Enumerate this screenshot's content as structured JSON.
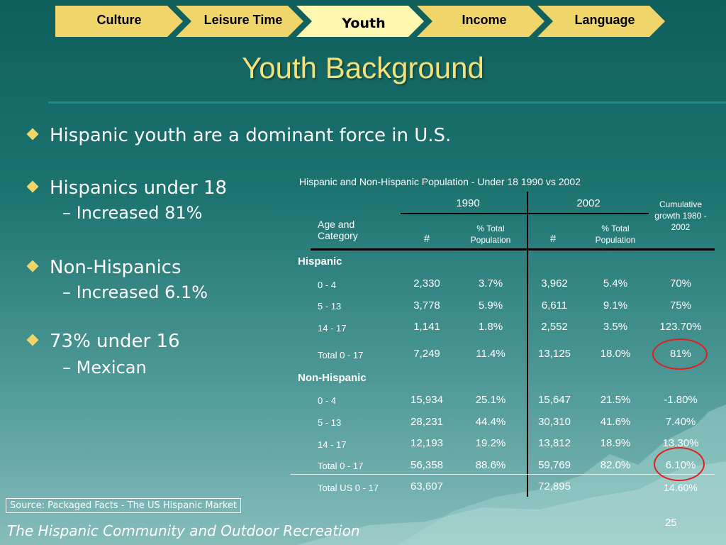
{
  "nav": {
    "tabs": [
      {
        "label": "Culture"
      },
      {
        "label": "Leisure Time"
      },
      {
        "label": "Youth"
      },
      {
        "label": "Income"
      },
      {
        "label": "Language"
      }
    ]
  },
  "slide": {
    "title": "Youth Background",
    "bullets": [
      {
        "text": "Hispanic youth are a dominant force in U.S."
      },
      {
        "text": "Hispanics under 18",
        "sub": "Increased 81%"
      },
      {
        "text": "Non-Hispanics",
        "sub": "Increased 6.1%"
      },
      {
        "text": "73% under 16",
        "sub": "Mexican"
      }
    ],
    "dash": "–"
  },
  "table": {
    "caption": "Hispanic and Non-Hispanic Population - Under 18      1990 vs 2002",
    "year_1990": "1990",
    "year_2002": "2002",
    "col_age": "Age and Category",
    "col_num": "#",
    "col_pct": "% Total Population",
    "col_growth": "Cumulative growth 1980 - 2002",
    "groups": [
      {
        "name": "Hispanic",
        "rows": [
          {
            "label": "0 - 4",
            "n1990": "2,330",
            "p1990": "3.7%",
            "n2002": "3,962",
            "p2002": "5.4%",
            "growth": "70%"
          },
          {
            "label": "5 - 13",
            "n1990": "3,778",
            "p1990": "5.9%",
            "n2002": "6,611",
            "p2002": "9.1%",
            "growth": "75%"
          },
          {
            "label": "14 - 17",
            "n1990": "1,141",
            "p1990": "1.8%",
            "n2002": "2,552",
            "p2002": "3.5%",
            "growth": "123.70%"
          },
          {
            "label": "Total 0 - 17",
            "n1990": "7,249",
            "p1990": "11.4%",
            "n2002": "13,125",
            "p2002": "18.0%",
            "growth": "81%"
          }
        ]
      },
      {
        "name": "Non-Hispanic",
        "rows": [
          {
            "label": "0 - 4",
            "n1990": "15,934",
            "p1990": "25.1%",
            "n2002": "15,647",
            "p2002": "21.5%",
            "growth": "-1.80%"
          },
          {
            "label": "5 - 13",
            "n1990": "28,231",
            "p1990": "44.4%",
            "n2002": "30,310",
            "p2002": "41.6%",
            "growth": "7.40%"
          },
          {
            "label": "14 - 17",
            "n1990": "12,193",
            "p1990": "19.2%",
            "n2002": "13,812",
            "p2002": "18.9%",
            "growth": "13.30%"
          },
          {
            "label": "Total 0 - 17",
            "n1990": "56,358",
            "p1990": "88.6%",
            "n2002": "59,769",
            "p2002": "82.0%",
            "growth": "6.10%"
          }
        ]
      }
    ],
    "total_us": {
      "label": "Total US 0 - 17",
      "n1990": "63,607",
      "n2002": "72,895",
      "growth": "14.60%"
    }
  },
  "source": "Source: Packaged Facts - The US Hispanic Market",
  "footer": "The Hispanic Community and Outdoor Recreation",
  "page_number": "25",
  "colors": {
    "tab": "#f0d66a",
    "tab_active": "#fff7b0",
    "title": "#f3e27a",
    "highlight": "#e0201f"
  }
}
